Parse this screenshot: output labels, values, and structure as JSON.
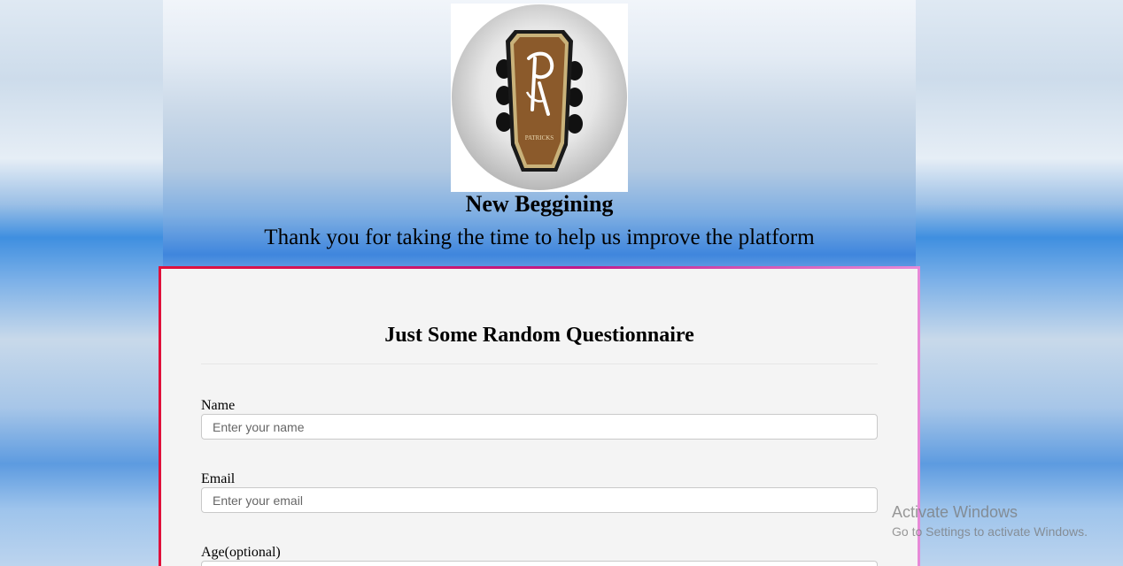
{
  "header": {
    "title": "New Beggining",
    "subtitle": "Thank you for taking the time to help us improve the platform",
    "logo_text": "PATRICKS"
  },
  "form": {
    "title": "Just Some Random Questionnaire",
    "fields": [
      {
        "label": "Name",
        "placeholder": "Enter your name"
      },
      {
        "label": "Email",
        "placeholder": "Enter your email"
      },
      {
        "label": "Age(optional)",
        "placeholder": ""
      }
    ]
  },
  "watermark": {
    "title": "Activate Windows",
    "subtitle": "Go to Settings to activate Windows."
  },
  "colors": {
    "panel_border_start": "#e0103a",
    "panel_border_end": "#e68ad8",
    "panel_background": "#f4f4f4",
    "logo_wood": "#8b5a2b"
  }
}
